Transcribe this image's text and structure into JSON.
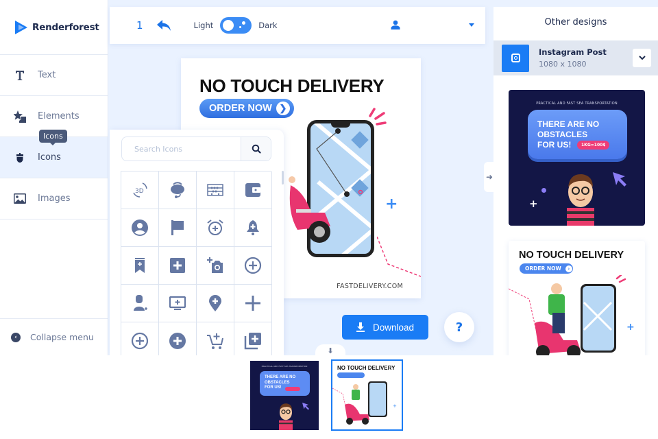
{
  "brand": {
    "name": "Renderforest"
  },
  "sidebar": {
    "items": [
      {
        "label": "Text",
        "icon": "text-icon"
      },
      {
        "label": "Elements",
        "icon": "elements-icon"
      },
      {
        "label": "Icons",
        "icon": "acorn-icon",
        "active": true
      },
      {
        "label": "Images",
        "icon": "image-icon"
      }
    ],
    "tooltip": "Icons",
    "collapse_label": "Collapse menu"
  },
  "topbar": {
    "page_number": "1",
    "theme_light": "Light",
    "theme_dark": "Dark",
    "theme_toggle_on": false
  },
  "icons_panel": {
    "search_placeholder": "Search Icons",
    "search_value": "",
    "icons": [
      "3d-rotate-icon",
      "headset-icon",
      "abacus-icon",
      "wallet-icon",
      "account-circle-icon",
      "flag-icon",
      "alarm-add-icon",
      "bell-add-icon",
      "bookmark-add-icon",
      "add-box-icon",
      "add-a-photo-icon",
      "add-circle-outline-icon",
      "person-add-icon",
      "add-to-queue-icon",
      "add-location-icon",
      "plus-icon",
      "add-circle-outline-2-icon",
      "add-circle-icon",
      "add-shopping-cart-icon",
      "library-add-icon"
    ]
  },
  "design": {
    "headline": "NO TOUCH DELIVERY",
    "cta": "ORDER NOW",
    "website": "FASTDELIVERY.COM"
  },
  "actions": {
    "download_label": "Download",
    "help_label": "?"
  },
  "right_panel": {
    "title": "Other designs",
    "format_name": "Instagram Post",
    "format_size": "1080 x 1080",
    "thumbs": [
      {
        "subtitle": "PRACTICAL AND FAST SEA TRANSPORTATION",
        "headline": "THERE ARE NO OBSTACLES FOR US!",
        "price": "1KG=100$"
      },
      {
        "headline": "NO TOUCH DELIVERY",
        "cta": "ORDER NOW"
      }
    ]
  },
  "colors": {
    "accent": "#1a7cf5",
    "dark_navy": "#131646",
    "pink": "#ee3c77",
    "icon_gray": "#6578a3"
  }
}
